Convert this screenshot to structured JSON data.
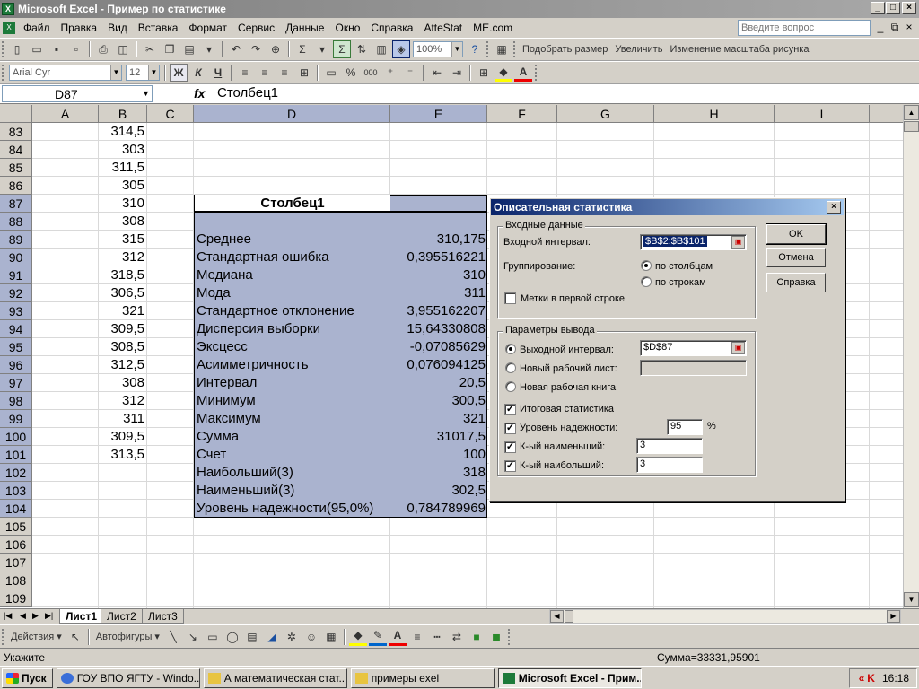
{
  "window": {
    "title": "Microsoft Excel - Пример по статистике"
  },
  "menu": {
    "items": [
      "Файл",
      "Правка",
      "Вид",
      "Вставка",
      "Формат",
      "Сервис",
      "Данные",
      "Окно",
      "Справка",
      "AtteStat",
      "ME.com"
    ],
    "ask_placeholder": "Введите вопрос"
  },
  "toolbar": {
    "zoom": "100%",
    "fit_size": "Подобрать размер",
    "enlarge": "Увеличить",
    "scale": "Изменение масштаба рисунка",
    "font": "Arial Cyr",
    "font_size": "12",
    "bold": "Ж",
    "italic": "К",
    "underline": "Ч",
    "percent": "%",
    "thousands": "000"
  },
  "formula": {
    "cell": "D87",
    "fx": "fx",
    "value": "Столбец1"
  },
  "columns": [
    "A",
    "B",
    "C",
    "D",
    "E",
    "F",
    "G",
    "H",
    "I"
  ],
  "rows": [
    "83",
    "84",
    "85",
    "86",
    "87",
    "88",
    "89",
    "90",
    "91",
    "92",
    "93",
    "94",
    "95",
    "96",
    "97",
    "98",
    "99",
    "100",
    "101",
    "102",
    "103",
    "104",
    "105",
    "106",
    "107",
    "108",
    "109"
  ],
  "col_b": [
    "314,5",
    "303",
    "311,5",
    "305",
    "310",
    "308",
    "315",
    "312",
    "318,5",
    "306,5",
    "321",
    "309,5",
    "308,5",
    "312,5",
    "308",
    "312",
    "311",
    "309,5",
    "313,5"
  ],
  "stats": {
    "title": "Столбец1",
    "rows": [
      {
        "label": "Среднее",
        "value": "310,175"
      },
      {
        "label": "Стандартная ошибка",
        "value": "0,395516221"
      },
      {
        "label": "Медиана",
        "value": "310"
      },
      {
        "label": "Мода",
        "value": "311"
      },
      {
        "label": "Стандартное отклонение",
        "value": "3,955162207"
      },
      {
        "label": "Дисперсия выборки",
        "value": "15,64330808"
      },
      {
        "label": "Эксцесс",
        "value": "-0,07085629"
      },
      {
        "label": "Асимметричность",
        "value": "0,076094125"
      },
      {
        "label": "Интервал",
        "value": "20,5"
      },
      {
        "label": "Минимум",
        "value": "300,5"
      },
      {
        "label": "Максимум",
        "value": "321"
      },
      {
        "label": "Сумма",
        "value": "31017,5"
      },
      {
        "label": "Счет",
        "value": "100"
      },
      {
        "label": "Наибольший(3)",
        "value": "318"
      },
      {
        "label": "Наименьший(3)",
        "value": "302,5"
      },
      {
        "label": "Уровень надежности(95,0%)",
        "value": "0,784789969"
      }
    ]
  },
  "dialog": {
    "title": "Описательная статистика",
    "input_group": "Входные данные",
    "input_range_label": "Входной интервал:",
    "input_range_value": "$B$2:$B$101",
    "grouping_label": "Группирование:",
    "by_columns": "по столбцам",
    "by_rows": "по строкам",
    "labels_first_row": "Метки в первой строке",
    "output_group": "Параметры вывода",
    "output_range_label": "Выходной интервал:",
    "output_range_value": "$D$87",
    "new_sheet": "Новый рабочий лист:",
    "new_book": "Новая рабочая книга",
    "summary": "Итоговая статистика",
    "confidence": "Уровень надежности:",
    "confidence_value": "95",
    "percent": "%",
    "kth_smallest": "К-ый наименьший:",
    "kth_smallest_value": "3",
    "kth_largest": "К-ый наибольший:",
    "kth_largest_value": "3",
    "ok": "OK",
    "cancel": "Отмена",
    "help": "Справка"
  },
  "sheets": [
    "Лист1",
    "Лист2",
    "Лист3"
  ],
  "drawing": {
    "actions": "Действия",
    "autoshapes": "Автофигуры"
  },
  "status": {
    "mode": "Укажите",
    "sum": "Сумма=33331,95901"
  },
  "taskbar": {
    "start": "Пуск",
    "tasks": [
      "ГОУ ВПО ЯГТУ - Windo...",
      "А математическая стат...",
      "примеры exel",
      "Microsoft Excel - Прим..."
    ],
    "clock": "16:18"
  }
}
